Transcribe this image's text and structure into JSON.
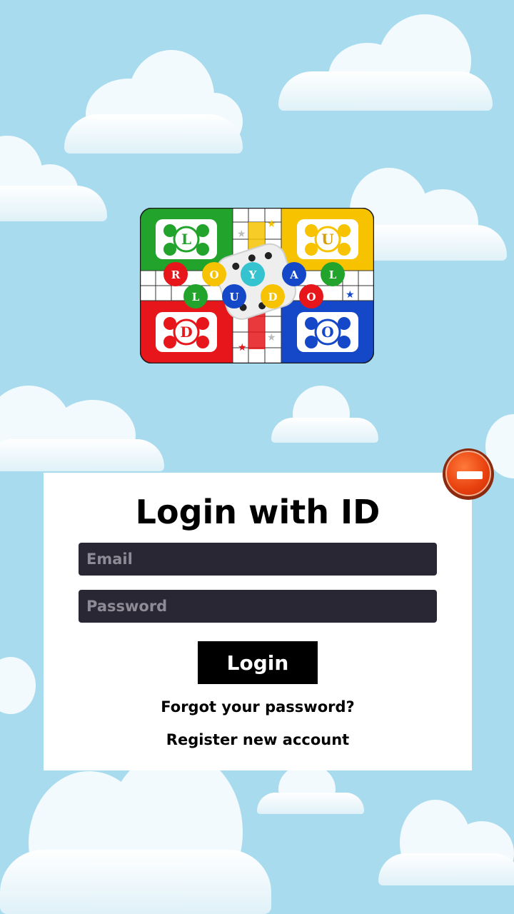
{
  "login_card": {
    "title": "Login with ID",
    "email_placeholder": "Email",
    "password_placeholder": "Password",
    "login_label": "Login",
    "forgot_label": "Forgot your password?",
    "register_label": "Register new account"
  },
  "logo": {
    "letters_row1": [
      "R",
      "O",
      "Y",
      "A",
      "L"
    ],
    "letters_row2": [
      "L",
      "U",
      "D",
      "O"
    ],
    "corner_letters": [
      "L",
      "U",
      "D",
      "O"
    ]
  },
  "colors": {
    "sky": "#a9dbee",
    "field": "#2a2735",
    "button": "#000000",
    "ludo_green": "#21a32c",
    "ludo_yellow": "#f7c300",
    "ludo_red": "#e6161a",
    "ludo_blue": "#1548c8",
    "close_button": "#e8400e"
  },
  "icons": {
    "close": "minus-circle-icon"
  }
}
